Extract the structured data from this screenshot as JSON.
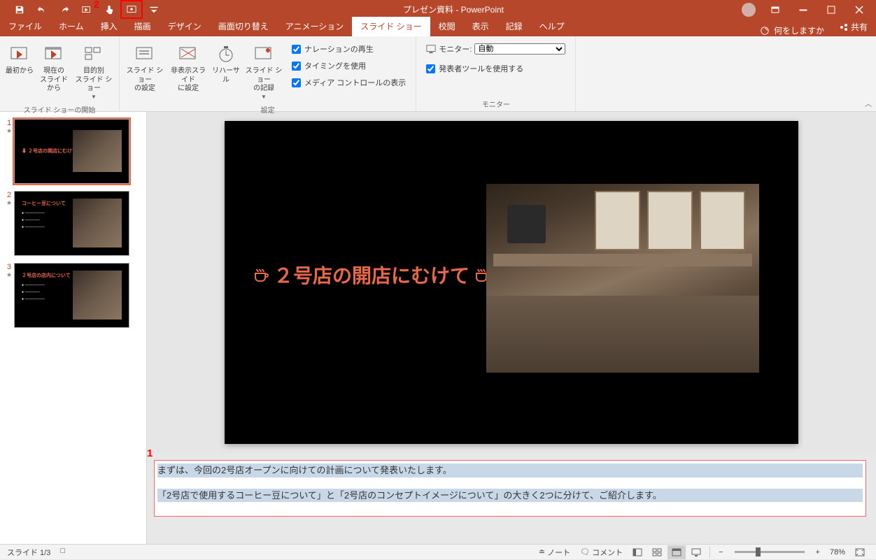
{
  "title": "プレゼン資料 - PowerPoint",
  "qat_badge": "2",
  "tabs": {
    "file": "ファイル",
    "home": "ホーム",
    "insert": "挿入",
    "draw": "描画",
    "design": "デザイン",
    "transitions": "画面切り替え",
    "animations": "アニメーション",
    "slideshow": "スライド ショー",
    "review": "校閲",
    "view": "表示",
    "record": "記録",
    "help": "ヘルプ",
    "tellme": "何をしますか",
    "share": "共有"
  },
  "ribbon": {
    "group1": {
      "label": "スライド ショーの開始",
      "from_start": "最初から",
      "from_current": "現在の\nスライドから",
      "custom": "目的別\nスライド ショー"
    },
    "group2": {
      "label": "設定",
      "setup": "スライド ショー\nの設定",
      "hide": "非表示スライド\nに設定",
      "rehearse": "リハーサル",
      "record": "スライド ショー\nの記録",
      "narration": "ナレーションの再生",
      "timing": "タイミングを使用",
      "media": "メディア コントロールの表示"
    },
    "group3": {
      "label": "モニター",
      "monitor_label": "モニター:",
      "monitor_value": "自動",
      "presenter": "発表者ツールを使用する"
    }
  },
  "slides": {
    "s1": {
      "num": "1",
      "title": "２号店の開店にむけて"
    },
    "s2": {
      "num": "2",
      "title": "コーヒー豆について"
    },
    "s3": {
      "num": "3",
      "title": "２号店の店内について"
    }
  },
  "current_slide": {
    "title": "２号店の開店にむけて"
  },
  "notes": {
    "marker": "1",
    "line1": "まずは、今回の2号店オープンに向けての計画について発表いたします。",
    "line2": "「2号店で使用するコーヒー豆について」と「2号店のコンセプトイメージについて」の大きく2つに分けて、ご紹介します。"
  },
  "status": {
    "slide_indicator": "スライド 1/3",
    "notes_btn": "ノート",
    "comments_btn": "コメント",
    "zoom": "78%"
  }
}
